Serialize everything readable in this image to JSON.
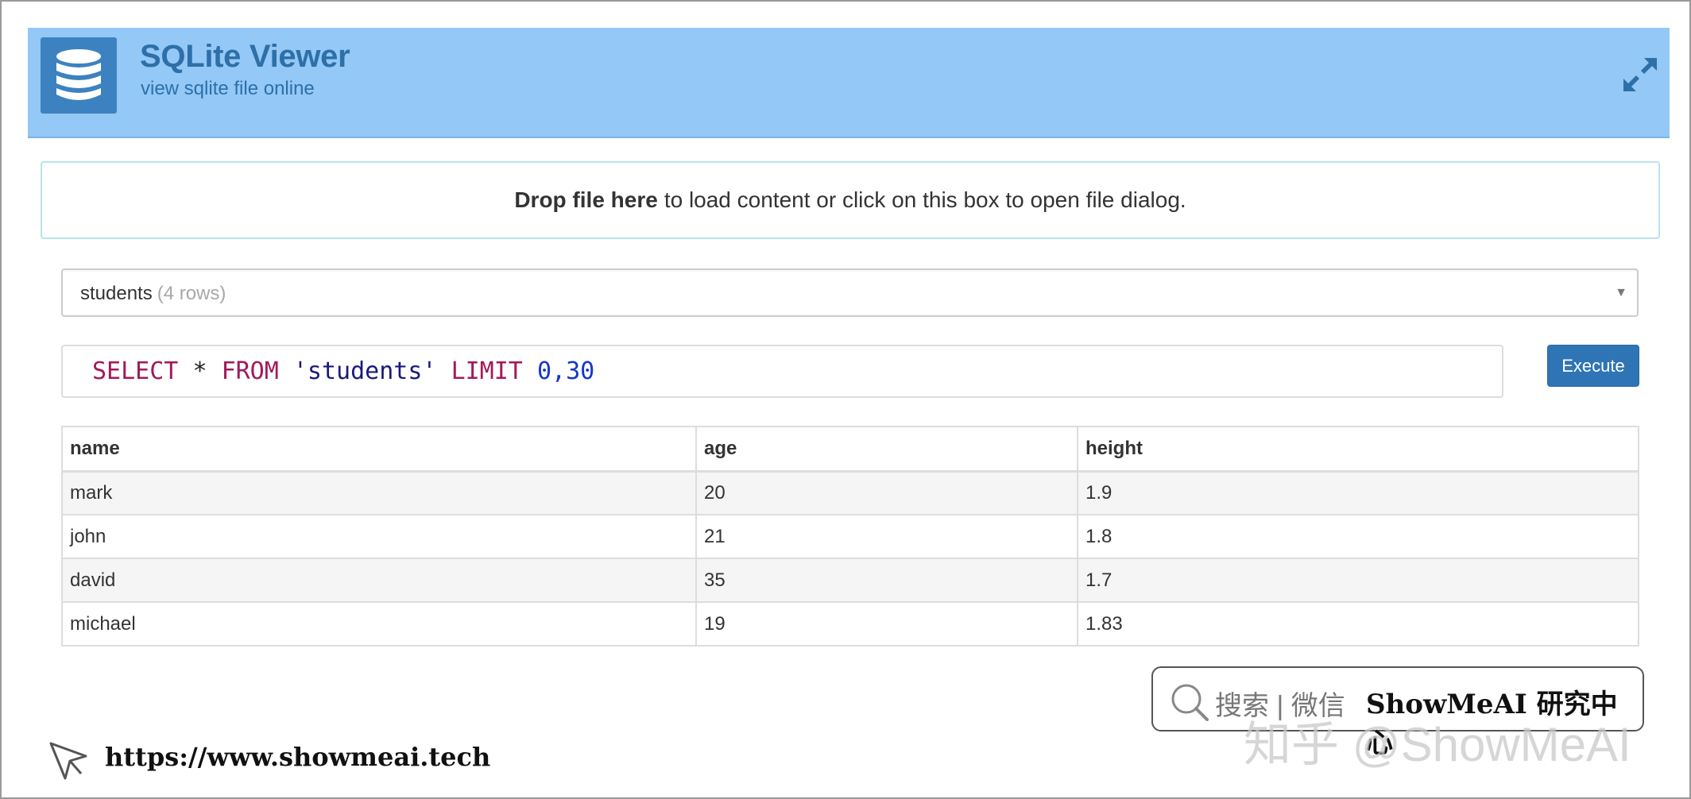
{
  "header": {
    "title": "SQLite Viewer",
    "subtitle": "view sqlite file online",
    "logo_icon": "database-icon",
    "expand_icon": "expand-arrows-icon"
  },
  "dropzone": {
    "bold": "Drop file here",
    "rest": "to load content or click on this box to open file dialog."
  },
  "table_select": {
    "name": "students",
    "rows": "(4 rows)"
  },
  "query": {
    "select": "SELECT",
    "star": "*",
    "from": "FROM",
    "table": "'students'",
    "limit": "LIMIT",
    "n1": "0",
    "comma": ",",
    "n2": "30"
  },
  "execute_label": "Execute",
  "results": {
    "columns": [
      "name",
      "age",
      "height"
    ],
    "rows": [
      [
        "mark",
        "20",
        "1.9"
      ],
      [
        "john",
        "21",
        "1.8"
      ],
      [
        "david",
        "35",
        "1.7"
      ],
      [
        "michael",
        "19",
        "1.83"
      ]
    ]
  },
  "watermark": {
    "search_text": "搜索 | 微信",
    "brand": "ShowMeAI 研究中心",
    "zhihu": "知乎 @ShowMeAI",
    "url": "https://www.showmeai.tech"
  },
  "colors": {
    "header_bg": "#93c8f7",
    "accent": "#2f75b5",
    "keyword": "#a3195b",
    "number": "#1537c9"
  }
}
